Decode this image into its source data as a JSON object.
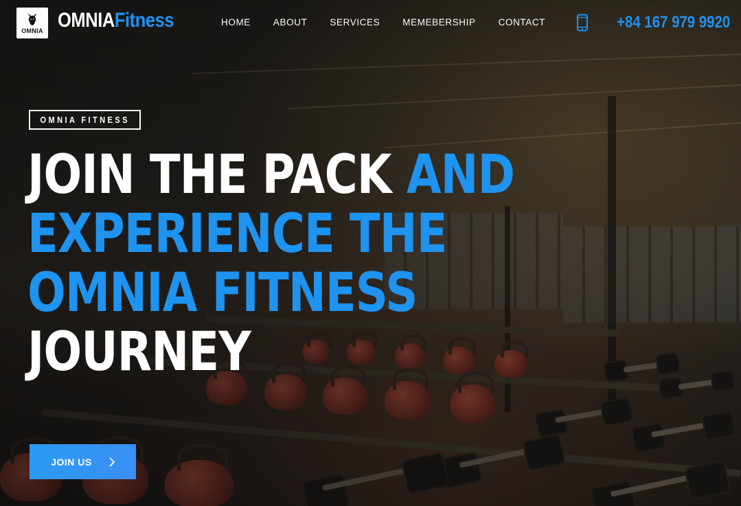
{
  "header": {
    "logo_text": "OMNIA",
    "brand_first": "OMNIA",
    "brand_second": "Fitness",
    "phone": "+84 167 979 9920"
  },
  "nav": {
    "items": [
      {
        "label": "HOME"
      },
      {
        "label": "ABOUT"
      },
      {
        "label": "SERVICES"
      },
      {
        "label": "MEMEBERSHIP"
      },
      {
        "label": "CONTACT"
      }
    ]
  },
  "hero": {
    "tagline": "OMNIA FITNESS",
    "headline": {
      "line1_white": "JOIN THE PACK ",
      "line1_blue": "AND",
      "line2_blue": "EXPERIENCE THE",
      "line3_blue": "OMNIA FITNESS",
      "line4_white": "JOURNEY"
    },
    "cta_label": "JOIN US"
  },
  "colors": {
    "accent": "#1e93f0",
    "text": "#ffffff"
  },
  "icons": {
    "logo": "wolf-icon",
    "phone": "phone-icon",
    "cta": "chevron-right-icon"
  }
}
